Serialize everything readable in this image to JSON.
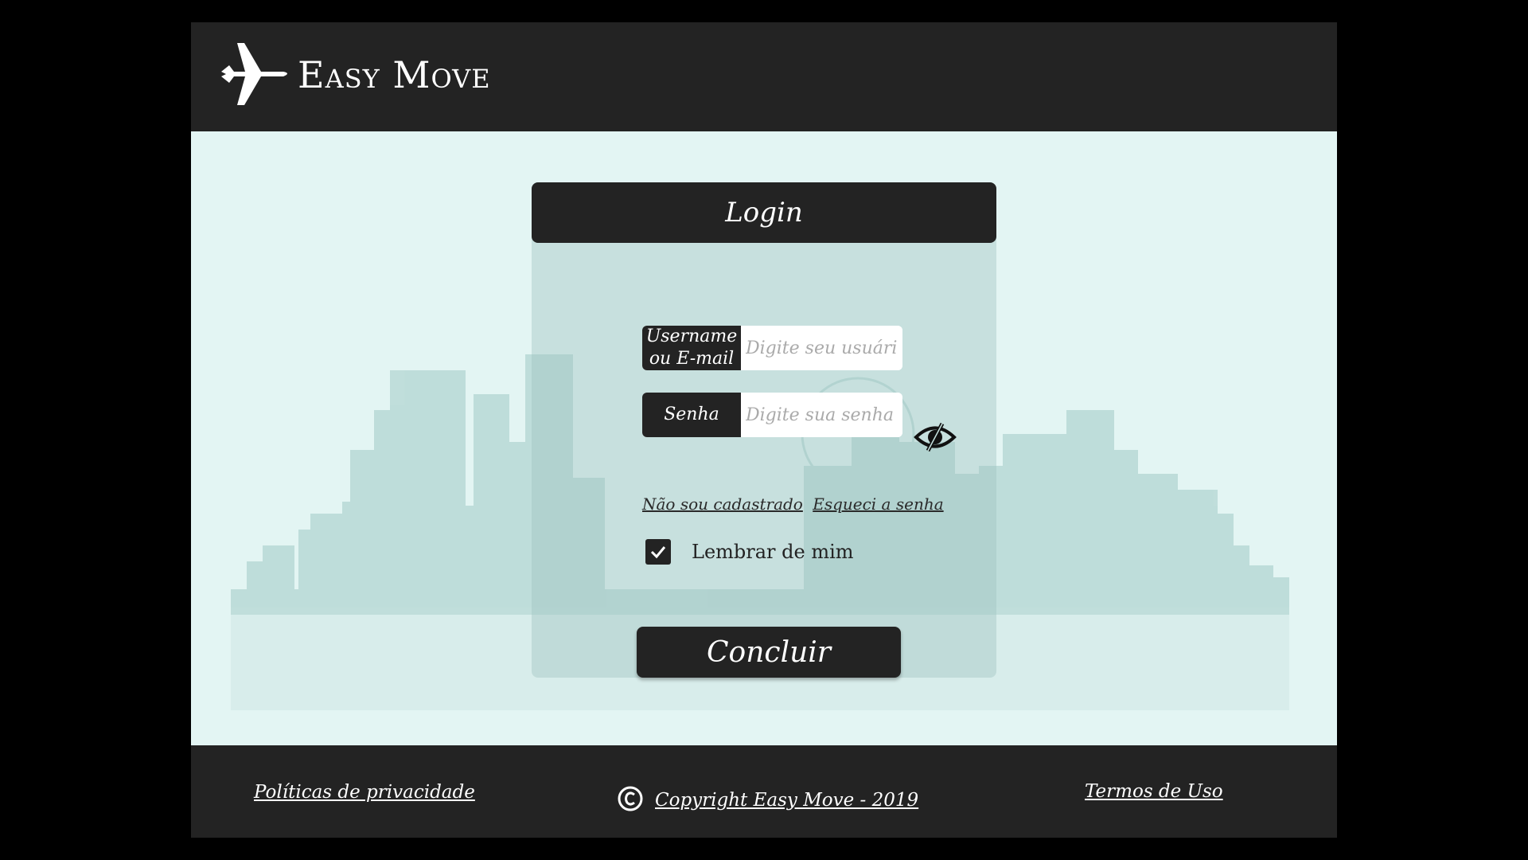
{
  "header": {
    "brand": "Easy Move",
    "logo_icon": "airplane-icon"
  },
  "login": {
    "title": "Login",
    "username": {
      "label_line1": "Username",
      "label_line2": "ou E-mail",
      "value": "",
      "placeholder": "Digite seu usuário"
    },
    "password": {
      "label": "Senha",
      "value": "",
      "placeholder": "Digite sua senha",
      "toggle_icon": "eye-slash-icon"
    },
    "links": {
      "register": "Não sou cadastrado",
      "forgot": "Esqueci a senha"
    },
    "remember": {
      "label": "Lembrar de mim",
      "checked": true
    },
    "submit_label": "Concluir"
  },
  "footer": {
    "privacy": "Políticas de privacidade",
    "copyright": "Copyright Easy Move - 2019",
    "copyright_icon": "copyright-icon",
    "terms": "Termos de Uso"
  },
  "colors": {
    "dark": "#232323",
    "background": "#e3f5f3",
    "skyline": "#b4d7d4"
  }
}
